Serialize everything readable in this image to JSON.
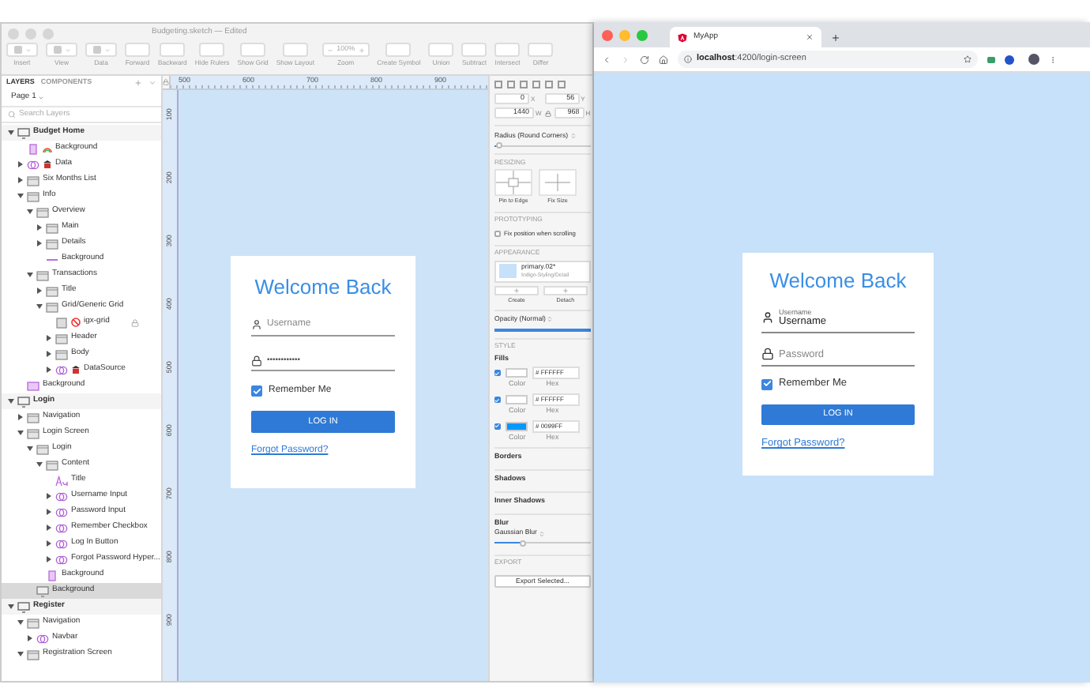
{
  "sketch": {
    "title": "Budgeting.sketch — Edited",
    "toolbar": [
      {
        "label": "Insert",
        "kind": "menu"
      },
      {
        "label": "View",
        "kind": "menu"
      },
      {
        "label": "Data",
        "kind": "menu"
      },
      {
        "label": "Forward",
        "kind": "tool"
      },
      {
        "label": "Backward",
        "kind": "tool"
      },
      {
        "label": "Hide Rulers",
        "kind": "tool"
      },
      {
        "label": "Show Grid",
        "kind": "tool"
      },
      {
        "label": "Show Layout",
        "kind": "tool"
      },
      {
        "label": "Zoom",
        "kind": "zoom",
        "value": "100%"
      },
      {
        "label": "Create Symbol",
        "kind": "tool"
      },
      {
        "label": "Union",
        "kind": "tool"
      },
      {
        "label": "Subtract",
        "kind": "tool"
      },
      {
        "label": "Intersect",
        "kind": "tool"
      },
      {
        "label": "Differ",
        "kind": "tool"
      }
    ],
    "layers": {
      "tabs": [
        {
          "label": "LAYERS",
          "selected": true
        },
        {
          "label": "COMPONENTS",
          "selected": false
        }
      ],
      "page": "Page 1",
      "search": {
        "placeholder": "Search Layers"
      },
      "tree": [
        {
          "label": "Budget Home",
          "kind": "artboard",
          "expanded": true,
          "selected": false,
          "children": [
            {
              "label": "Background",
              "kind": "styled",
              "selected": false
            },
            {
              "label": "Data",
              "kind": "datasymbol",
              "expanded": false,
              "selected": false
            },
            {
              "label": "Six Months List",
              "kind": "group",
              "expanded": false,
              "selected": false
            },
            {
              "label": "Info",
              "kind": "group",
              "expanded": true,
              "selected": false,
              "children": [
                {
                  "label": "Overview",
                  "kind": "group",
                  "expanded": true,
                  "selected": false,
                  "children": [
                    {
                      "label": "Main",
                      "kind": "group",
                      "expanded": false,
                      "selected": false
                    },
                    {
                      "label": "Details",
                      "kind": "group",
                      "expanded": false,
                      "selected": false
                    },
                    {
                      "label": "Background",
                      "kind": "line",
                      "selected": false
                    }
                  ]
                },
                {
                  "label": "Transactions",
                  "kind": "group",
                  "expanded": true,
                  "selected": false,
                  "children": [
                    {
                      "label": "Title",
                      "kind": "group",
                      "expanded": false,
                      "selected": false
                    },
                    {
                      "label": "Grid/Generic Grid",
                      "kind": "group",
                      "expanded": true,
                      "selected": false,
                      "children": [
                        {
                          "label": "igx-grid",
                          "kind": "blocked",
                          "locked": true,
                          "selected": false
                        },
                        {
                          "label": "Header",
                          "kind": "group",
                          "expanded": false,
                          "selected": false
                        },
                        {
                          "label": "Body",
                          "kind": "group",
                          "expanded": false,
                          "selected": false
                        },
                        {
                          "label": "DataSource",
                          "kind": "datasymbol",
                          "expanded": false,
                          "selected": false
                        }
                      ]
                    }
                  ]
                }
              ]
            },
            {
              "label": "Background",
              "kind": "image",
              "selected": false
            }
          ]
        },
        {
          "label": "Login",
          "kind": "artboard",
          "expanded": true,
          "selected": false,
          "children": [
            {
              "label": "Navigation",
              "kind": "group",
              "expanded": false,
              "selected": false
            },
            {
              "label": "Login Screen",
              "kind": "group",
              "expanded": true,
              "selected": false,
              "children": [
                {
                  "label": "Login",
                  "kind": "group",
                  "expanded": true,
                  "selected": false,
                  "children": [
                    {
                      "label": "Content",
                      "kind": "group",
                      "expanded": true,
                      "selected": false,
                      "children": [
                        {
                          "label": "Title",
                          "kind": "text",
                          "selected": false
                        },
                        {
                          "label": "Username Input",
                          "kind": "symbol",
                          "expanded": false,
                          "selected": false
                        },
                        {
                          "label": "Password Input",
                          "kind": "symbol",
                          "expanded": false,
                          "selected": false
                        },
                        {
                          "label": "Remember Checkbox",
                          "kind": "symbol",
                          "expanded": false,
                          "selected": false
                        },
                        {
                          "label": "Log In Button",
                          "kind": "symbol",
                          "expanded": false,
                          "selected": false
                        },
                        {
                          "label": "Forgot Password Hyper...",
                          "kind": "symbol",
                          "expanded": false,
                          "selected": false
                        }
                      ]
                    },
                    {
                      "label": "Background",
                      "kind": "rect",
                      "selected": false
                    }
                  ]
                },
                {
                  "label": "Background",
                  "kind": "screen",
                  "selected": true
                }
              ]
            }
          ]
        },
        {
          "label": "Register",
          "kind": "artboard",
          "expanded": true,
          "selected": false,
          "children": [
            {
              "label": "Navigation",
              "kind": "group",
              "expanded": true,
              "selected": false,
              "children": [
                {
                  "label": "Navbar",
                  "kind": "symbol",
                  "expanded": false,
                  "selected": false
                }
              ]
            },
            {
              "label": "Registration Screen",
              "kind": "group",
              "expanded": true,
              "selected": false
            }
          ]
        }
      ]
    },
    "rulers": {
      "horizontal": [
        "500",
        "600",
        "700",
        "800",
        "900"
      ],
      "vertical": [
        "100",
        "200",
        "300",
        "400",
        "500",
        "600",
        "700",
        "800",
        "900"
      ]
    },
    "card": {
      "title": "Welcome Back",
      "username": {
        "placeholder": "Username"
      },
      "password": {
        "value": "••••••••••••"
      },
      "remember": {
        "label": "Remember Me",
        "checked": true
      },
      "button": "LOG IN",
      "link": "Forgot Password?"
    },
    "inspector": {
      "position": [
        {
          "label": "X",
          "value": "0"
        },
        {
          "label": "Y",
          "value": "56"
        }
      ],
      "size": [
        {
          "label": "W",
          "value": "1440"
        },
        {
          "label": "H",
          "value": "968"
        }
      ],
      "radius": {
        "label": "Radius (Round Corners)",
        "level": 0.05
      },
      "resizing": {
        "heading": "RESIZING",
        "options": [
          "Pin to Edge",
          "Fix Size"
        ]
      },
      "prototyping": {
        "heading": "PROTOTYPING",
        "fix": {
          "label": "Fix position when scrolling",
          "checked": false
        }
      },
      "appearance": {
        "heading": "APPEARANCE",
        "style_name": "primary.02*",
        "style_path": "Indigo-Styling/Detail",
        "actions": [
          "Create",
          "Detach"
        ],
        "opacity": {
          "label": "Opacity (Normal)",
          "level": 1
        }
      },
      "style": {
        "heading": "STYLE",
        "fills_label": "Fills",
        "fills": [
          {
            "checked": true,
            "color": "#ffffff",
            "hex": "# FFFFFF",
            "color_caption": "Color",
            "hex_caption": "Hex"
          },
          {
            "checked": true,
            "color": "#ffffff",
            "hex": "# FFFFFF",
            "color_caption": "Color",
            "hex_caption": "Hex"
          },
          {
            "checked": true,
            "color": "#0099ff",
            "hex": "# 0099FF",
            "color_caption": "Color",
            "hex_caption": "Hex"
          }
        ],
        "sections": [
          "Borders",
          "Shadows",
          "Inner Shadows"
        ],
        "blur": {
          "label": "Blur",
          "type": "Gaussian Blur",
          "level": 0.3
        }
      },
      "export": {
        "heading": "EXPORT",
        "button": "Export Selected..."
      }
    }
  },
  "browser": {
    "tab": {
      "title": "MyApp"
    },
    "url": {
      "host": "localhost",
      "path": ":4200/login-screen"
    },
    "card": {
      "title": "Welcome Back",
      "username": {
        "label": "Username",
        "value": "Username"
      },
      "password": {
        "placeholder": "Password"
      },
      "remember": {
        "label": "Remember Me",
        "checked": true
      },
      "button": "LOG IN",
      "link": "Forgot Password?"
    }
  }
}
